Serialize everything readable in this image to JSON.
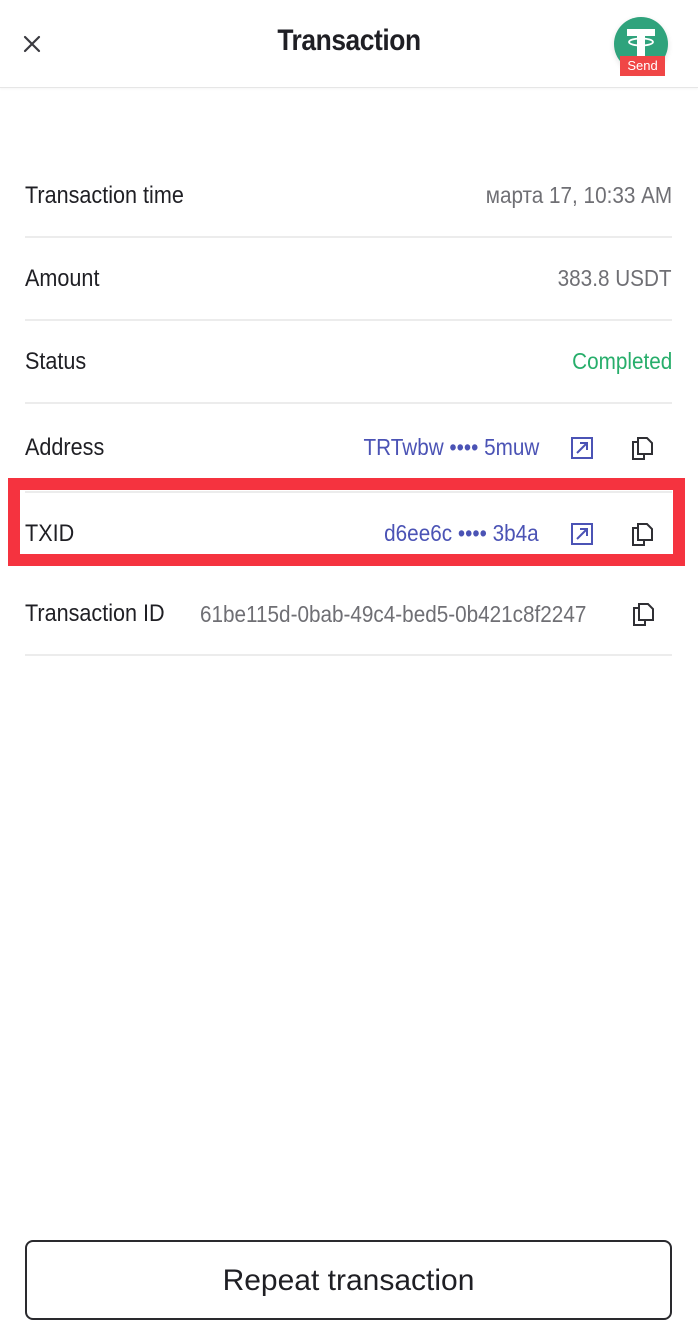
{
  "header": {
    "title": "Transaction",
    "close_icon": "close-icon",
    "token_icon": "tether-usdt-icon",
    "badge": "Send",
    "colors": {
      "token": "#2fa37c",
      "badge": "#f04646"
    }
  },
  "details": {
    "transaction_time": {
      "label": "Transaction time",
      "value": "марта 17, 10:33 AM"
    },
    "amount": {
      "label": "Amount",
      "value": "383.8 USDT"
    },
    "status": {
      "label": "Status",
      "value": "Completed",
      "color": "#27ae6b"
    },
    "address": {
      "label": "Address",
      "value": "TRTwbw •••• 5muw",
      "icons": [
        "external-link-icon",
        "copy-icon"
      ]
    },
    "txid": {
      "label": "TXID",
      "value": "d6ee6c •••• 3b4a",
      "icons": [
        "external-link-icon",
        "copy-icon"
      ],
      "highlighted": true
    },
    "transaction_id": {
      "label": "Transaction ID",
      "value": "61be115d-0bab-49c4-bed5-0b421c8f2247",
      "icons": [
        "copy-icon"
      ]
    }
  },
  "footer": {
    "repeat_button": "Repeat transaction"
  },
  "colors": {
    "link": "#4b53b5",
    "highlight": "#f5333f"
  }
}
